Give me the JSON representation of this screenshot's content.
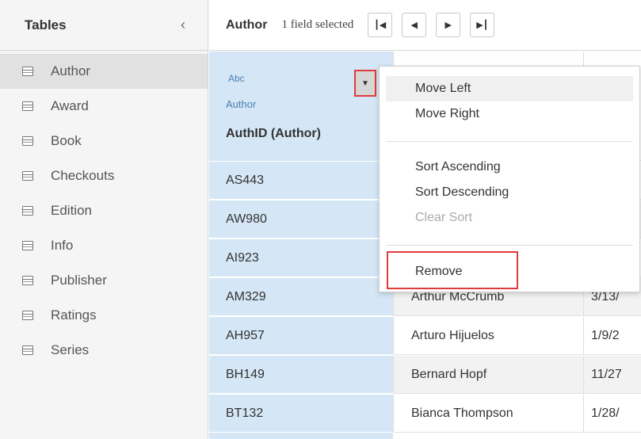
{
  "sidebar": {
    "title": "Tables",
    "collapse_icon": "chevron-left-icon",
    "items": [
      {
        "label": "Author"
      },
      {
        "label": "Award"
      },
      {
        "label": "Book"
      },
      {
        "label": "Checkouts"
      },
      {
        "label": "Edition"
      },
      {
        "label": "Info"
      },
      {
        "label": "Publisher"
      },
      {
        "label": "Ratings"
      },
      {
        "label": "Series"
      }
    ]
  },
  "toolbar": {
    "table_name": "Author",
    "status": "1 field selected"
  },
  "column": {
    "type_label": "Abc",
    "source": "Author",
    "field_name": "AuthID (Author)"
  },
  "rows": [
    {
      "id": "AS443",
      "name": "",
      "date": ""
    },
    {
      "id": "AW980",
      "name": "",
      "date": ""
    },
    {
      "id": "AI923",
      "name": "",
      "date": ""
    },
    {
      "id": "AM329",
      "name": "Arthur McCrumb",
      "date": "3/13/"
    },
    {
      "id": "AH957",
      "name": "Arturo Hijuelos",
      "date": "1/9/2"
    },
    {
      "id": "BH149",
      "name": "Bernard Hopf",
      "date": "11/27"
    },
    {
      "id": "BT132",
      "name": "Bianca Thompson",
      "date": "1/28/"
    }
  ],
  "menu": {
    "move_left": "Move Left",
    "move_right": "Move Right",
    "sort_ascending": "Sort Ascending",
    "sort_descending": "Sort Descending",
    "clear_sort": "Clear Sort",
    "remove": "Remove"
  },
  "colors": {
    "selected_column": "#d5e7f6",
    "highlight_border": "#e03a3a"
  }
}
